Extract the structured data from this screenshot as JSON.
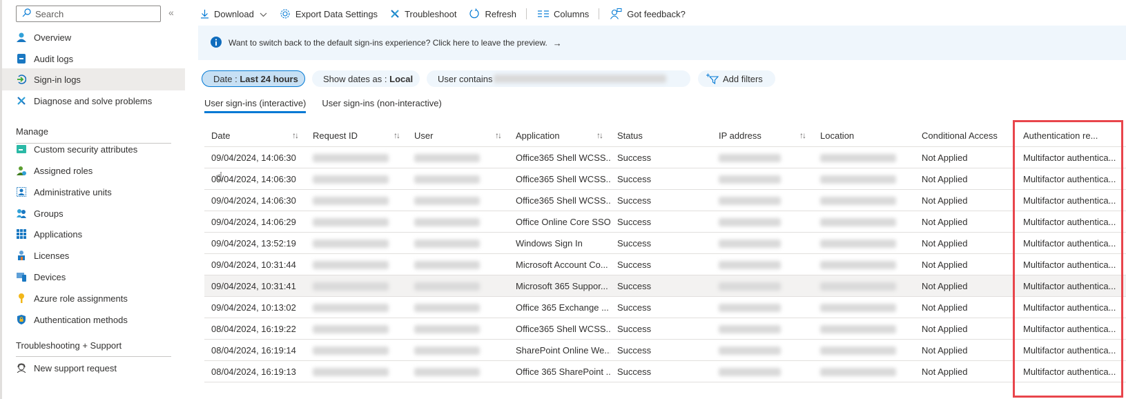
{
  "sidebar": {
    "search_placeholder": "Search",
    "collapse_icon": "double-chevron-left",
    "items_top": [
      {
        "label": "Overview",
        "icon": "user-icon",
        "active": false
      },
      {
        "label": "Audit logs",
        "icon": "book-icon",
        "active": false
      },
      {
        "label": "Sign-in logs",
        "icon": "sign-in-icon",
        "active": true
      },
      {
        "label": "Diagnose and solve problems",
        "icon": "wrench-icon",
        "active": false
      }
    ],
    "manage_title": "Manage",
    "manage_items": [
      {
        "label": "Custom security attributes",
        "icon": "attributes-icon"
      },
      {
        "label": "Assigned roles",
        "icon": "roles-icon"
      },
      {
        "label": "Administrative units",
        "icon": "admin-units-icon"
      },
      {
        "label": "Groups",
        "icon": "groups-icon"
      },
      {
        "label": "Applications",
        "icon": "apps-grid-icon"
      },
      {
        "label": "Licenses",
        "icon": "license-icon"
      },
      {
        "label": "Devices",
        "icon": "devices-icon"
      },
      {
        "label": "Azure role assignments",
        "icon": "key-icon"
      },
      {
        "label": "Authentication methods",
        "icon": "shield-icon"
      }
    ],
    "support_title": "Troubleshooting + Support",
    "support_items": [
      {
        "label": "New support request",
        "icon": "support-icon"
      }
    ]
  },
  "toolbar": {
    "download": "Download",
    "export": "Export Data Settings",
    "troubleshoot": "Troubleshoot",
    "refresh": "Refresh",
    "columns": "Columns",
    "feedback": "Got feedback?"
  },
  "banner": {
    "text": "Want to switch back to the default sign-ins experience? Click here to leave the preview.",
    "arrow": "→"
  },
  "filters": {
    "date_label": "Date : ",
    "date_value": "Last 24 hours",
    "dates_as_label": "Show dates as : ",
    "dates_as_value": "Local",
    "user_label": "User contains",
    "add_filters": "Add filters"
  },
  "tabs": [
    {
      "label": "User sign-ins (interactive)",
      "active": true
    },
    {
      "label": "User sign-ins (non-interactive)",
      "active": false
    }
  ],
  "table": {
    "columns": [
      {
        "label": "Date",
        "sortable": true
      },
      {
        "label": "Request ID",
        "sortable": true
      },
      {
        "label": "User",
        "sortable": true
      },
      {
        "label": "Application",
        "sortable": true
      },
      {
        "label": "Status",
        "sortable": false
      },
      {
        "label": "IP address",
        "sortable": true
      },
      {
        "label": "Location",
        "sortable": false
      },
      {
        "label": "Conditional Access",
        "sortable": false
      },
      {
        "label": "Authentication re...",
        "sortable": false
      }
    ],
    "sort_glyph": "↑↓",
    "rows": [
      {
        "date": "09/04/2024, 14:06:30",
        "application": "Office365 Shell WCSS...",
        "status": "Success",
        "ca": "Not Applied",
        "auth": "Multifactor authentica..."
      },
      {
        "date": "09/04/2024, 14:06:30",
        "application": "Office365 Shell WCSS...",
        "status": "Success",
        "ca": "Not Applied",
        "auth": "Multifactor authentica..."
      },
      {
        "date": "09/04/2024, 14:06:30",
        "application": "Office365 Shell WCSS...",
        "status": "Success",
        "ca": "Not Applied",
        "auth": "Multifactor authentica..."
      },
      {
        "date": "09/04/2024, 14:06:29",
        "application": "Office Online Core SSO",
        "status": "Success",
        "ca": "Not Applied",
        "auth": "Multifactor authentica..."
      },
      {
        "date": "09/04/2024, 13:52:19",
        "application": "Windows Sign In",
        "status": "Success",
        "ca": "Not Applied",
        "auth": "Multifactor authentica..."
      },
      {
        "date": "09/04/2024, 10:31:44",
        "application": "Microsoft Account Co...",
        "status": "Success",
        "ca": "Not Applied",
        "auth": "Multifactor authentica..."
      },
      {
        "date": "09/04/2024, 10:31:41",
        "application": "Microsoft 365 Suppor...",
        "status": "Success",
        "ca": "Not Applied",
        "auth": "Multifactor authentica..."
      },
      {
        "date": "09/04/2024, 10:13:02",
        "application": "Office 365 Exchange ...",
        "status": "Success",
        "ca": "Not Applied",
        "auth": "Multifactor authentica..."
      },
      {
        "date": "08/04/2024, 16:19:22",
        "application": "Office365 Shell WCSS...",
        "status": "Success",
        "ca": "Not Applied",
        "auth": "Multifactor authentica..."
      },
      {
        "date": "08/04/2024, 16:19:14",
        "application": "SharePoint Online We...",
        "status": "Success",
        "ca": "Not Applied",
        "auth": "Multifactor authentica..."
      },
      {
        "date": "08/04/2024, 16:19:13",
        "application": "Office 365 SharePoint ...",
        "status": "Success",
        "ca": "Not Applied",
        "auth": "Multifactor authentica..."
      }
    ],
    "highlighted_row": 6
  },
  "colors": {
    "accent": "#0078d4",
    "highlight_box": "#e8454b",
    "banner_bg": "#eff6fc",
    "active_nav_bg": "#edebe9"
  }
}
